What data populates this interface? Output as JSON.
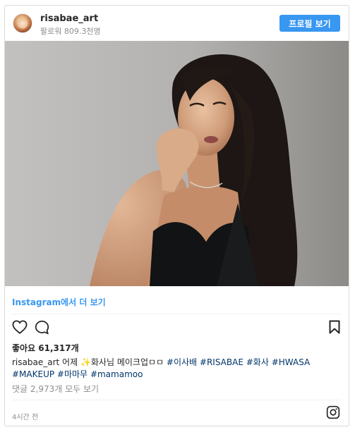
{
  "header": {
    "username": "risabae_art",
    "followers": "팔로워 809.3천명",
    "profile_button": "프로필 보기"
  },
  "post": {
    "view_on_instagram": "Instagram에서 더 보기",
    "likes": "좋아요 61,317개",
    "caption": {
      "author": "risabae_art",
      "text_1": " 어제 ",
      "sparkle": "✨",
      "text_2": "화사님 메이크업ㅁㅁ ",
      "tags": [
        "#이사배",
        "#RISABAE",
        "#화사",
        "#HWASA",
        "#MAKEUP",
        "#마마무",
        "#mamamoo"
      ]
    },
    "comments_link": "댓글 2,973개 모두 보기",
    "timestamp": "4시간 전"
  },
  "icons": {
    "like": "heart-icon",
    "comment": "comment-icon",
    "save": "bookmark-icon",
    "brand": "instagram-logo-icon"
  },
  "colors": {
    "accent": "#3897f0",
    "hashtag": "#003569",
    "muted": "#8e8e8e",
    "border": "#dbdbdb"
  }
}
